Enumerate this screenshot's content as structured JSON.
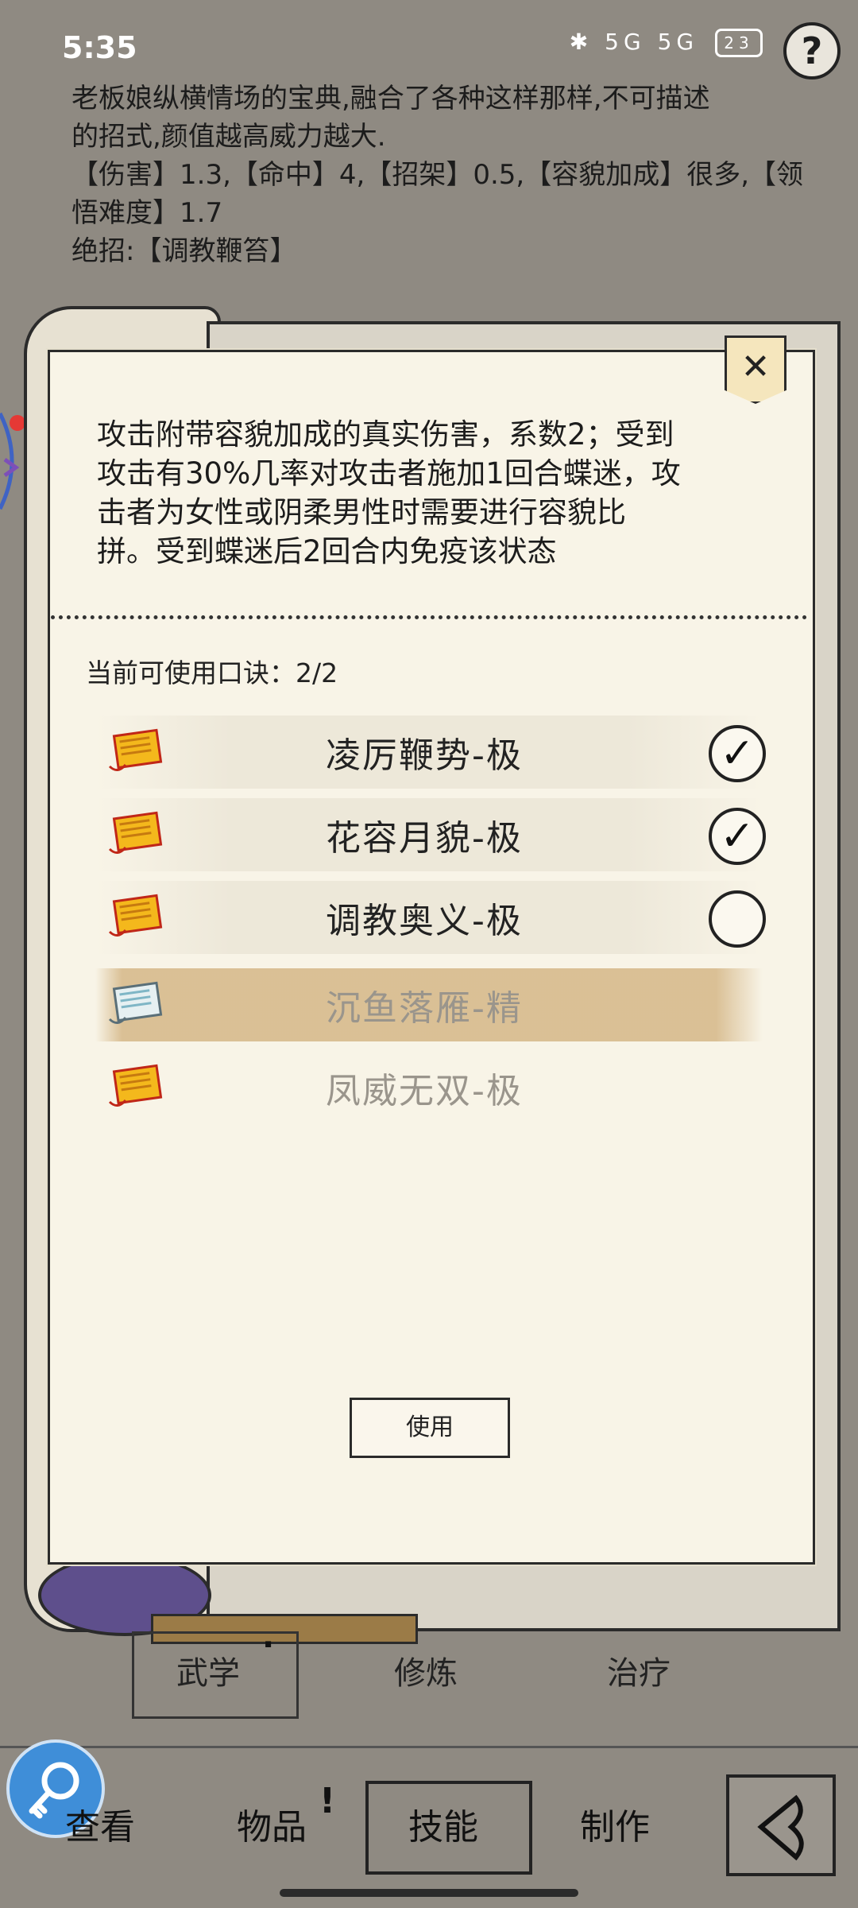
{
  "status_bar": {
    "time": "5:35",
    "icons": "✱ 5G 5G",
    "battery": "23"
  },
  "help_icon": "?",
  "item_description": {
    "lines": [
      "老板娘纵横情场的宝典,融合了各种这样那样,不可描述",
      "的招式,颜值越高威力越大.",
      "【伤害】1.3,【命中】4,【招架】0.5,【容貌加成】很多,【领",
      "悟难度】1.7",
      "绝招:【调教鞭笞】"
    ]
  },
  "panel": {
    "close_label": "✕",
    "effect_lines": [
      "攻击附带容貌加成的真实伤害，系数2；受到",
      "攻击有30%几率对攻击者施加1回合蝶迷，攻",
      "击者为女性或阴柔男性时需要进行容貌比",
      "拼。受到蝶迷后2回合内免疫该状态"
    ],
    "available_label": "当前可使用口诀：",
    "available_value": "2/2",
    "techniques": [
      {
        "name": "凌厉鞭势-极",
        "checked": true,
        "enabled": true
      },
      {
        "name": "花容月貌-极",
        "checked": true,
        "enabled": true
      },
      {
        "name": "调教奥义-极",
        "checked": false,
        "enabled": true
      },
      {
        "name": "沉鱼落雁-精",
        "checked": false,
        "enabled": false
      },
      {
        "name": "凤威无双-极",
        "checked": false,
        "enabled": false
      }
    ],
    "use_button": "使用"
  },
  "sub_tabs": {
    "martial": "武学",
    "cultivate": "修炼",
    "heal": "治疗"
  },
  "bottom_nav": {
    "view": "查看",
    "items": "物品",
    "skills": "技能",
    "craft": "制作"
  },
  "colors": {
    "background": "#8f8a82",
    "panel": "#f8f4e7",
    "selected_row": "#d5b787",
    "fab": "#3f8ed8"
  }
}
